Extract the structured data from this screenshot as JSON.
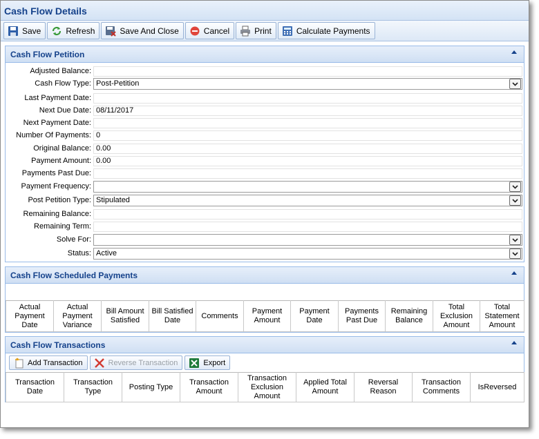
{
  "window": {
    "title": "Cash Flow Details"
  },
  "toolbar": {
    "buttons": [
      {
        "label": "Save",
        "icon": "save-icon"
      },
      {
        "label": "Refresh",
        "icon": "refresh-icon"
      },
      {
        "label": "Save And Close",
        "icon": "save-close-icon"
      },
      {
        "label": "Cancel",
        "icon": "cancel-icon"
      },
      {
        "label": "Print",
        "icon": "printer-icon"
      },
      {
        "label": "Calculate Payments",
        "icon": "calculator-icon"
      }
    ]
  },
  "petition": {
    "title": "Cash Flow Petition",
    "fields": {
      "adjusted_balance": {
        "label": "Adjusted Balance:",
        "value": ""
      },
      "cash_flow_type": {
        "label": "Cash Flow Type:",
        "value": "Post-Petition"
      },
      "last_payment_date": {
        "label": "Last Payment Date:",
        "value": ""
      },
      "next_due_date": {
        "label": "Next Due Date:",
        "value": "08/11/2017"
      },
      "next_payment_date": {
        "label": "Next Payment Date:",
        "value": ""
      },
      "number_of_payments": {
        "label": "Number Of Payments:",
        "value": "0"
      },
      "original_balance": {
        "label": "Original Balance:",
        "value": "0.00"
      },
      "payment_amount": {
        "label": "Payment Amount:",
        "value": "0.00"
      },
      "payments_past_due": {
        "label": "Payments Past Due:",
        "value": ""
      },
      "payment_frequency": {
        "label": "Payment Frequency:",
        "value": ""
      },
      "post_petition_type": {
        "label": "Post Petition Type:",
        "value": "Stipulated"
      },
      "remaining_balance": {
        "label": "Remaining Balance:",
        "value": ""
      },
      "remaining_term": {
        "label": "Remaining Term:",
        "value": ""
      },
      "solve_for": {
        "label": "Solve For:",
        "value": ""
      },
      "status": {
        "label": "Status:",
        "value": "Active"
      }
    }
  },
  "scheduled": {
    "title": "Cash Flow Scheduled Payments",
    "columns": [
      "Actual Payment Date",
      "Actual Payment Variance",
      "Bill Amount Satisfied",
      "Bill Satisfied Date",
      "Comments",
      "Payment Amount",
      "Payment Date",
      "Payments Past Due",
      "Remaining Balance",
      "Total Exclusion Amount",
      "Total Statement Amount"
    ]
  },
  "transactions": {
    "title": "Cash Flow Transactions",
    "buttons": [
      {
        "label": "Add Transaction",
        "icon": "add-transaction-icon"
      },
      {
        "label": "Reverse Transaction",
        "icon": "reverse-icon"
      },
      {
        "label": "Export",
        "icon": "excel-export-icon"
      }
    ],
    "columns": [
      "Transaction Date",
      "Transaction Type",
      "Posting Type",
      "Transaction Amount",
      "Transaction Exclusion Amount",
      "Applied Total Amount",
      "Reversal Reason",
      "Transaction Comments",
      "IsReversed"
    ]
  }
}
